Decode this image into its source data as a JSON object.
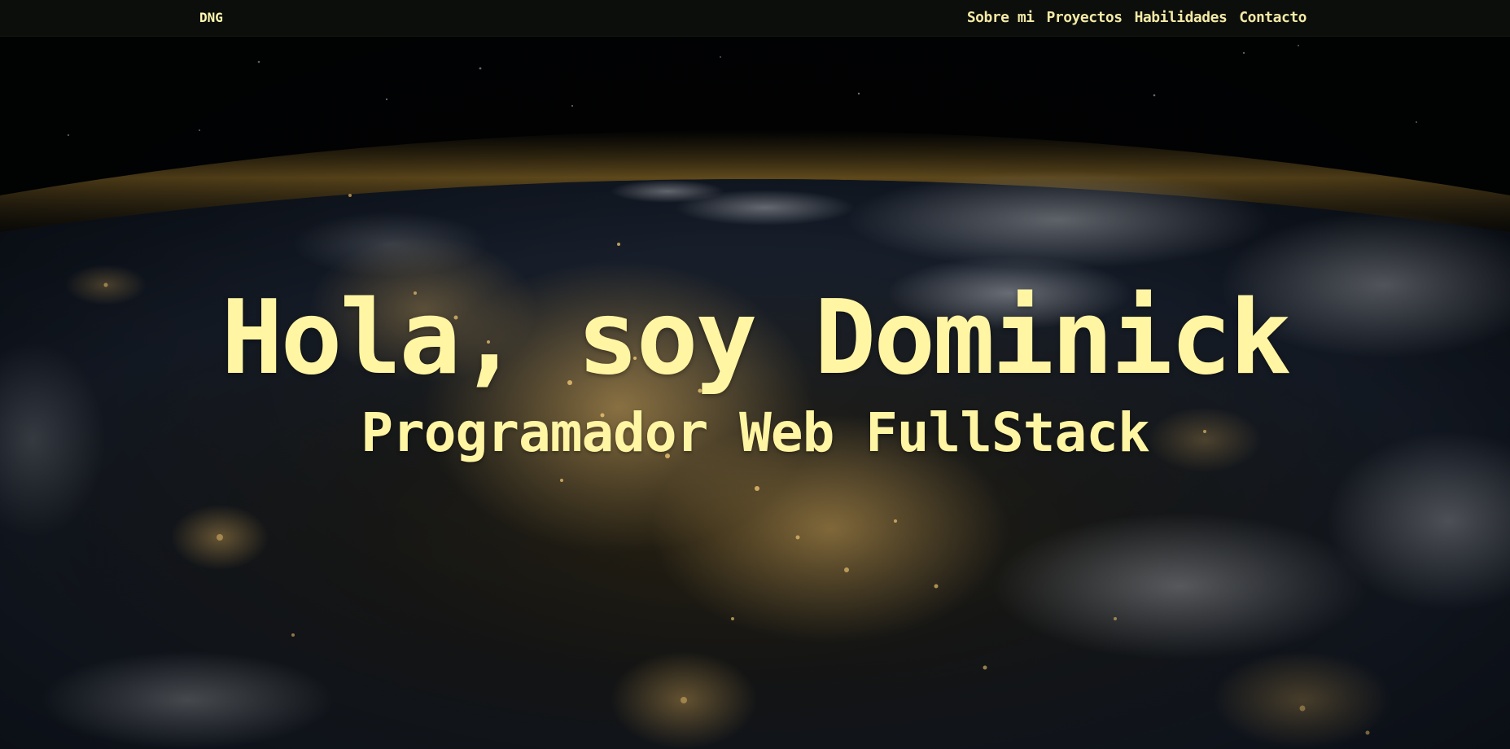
{
  "navbar": {
    "brand": "DNG",
    "links": [
      {
        "label": "Sobre mi"
      },
      {
        "label": "Proyectos"
      },
      {
        "label": "Habilidades"
      },
      {
        "label": "Contacto"
      }
    ]
  },
  "hero": {
    "title": "Hola, soy Dominick",
    "subtitle": "Programador Web FullStack"
  },
  "colors": {
    "accent_text": "#fff5a3",
    "navbar_bg": "#0b0e0a",
    "space_bg": "#020304",
    "atmosphere_glow": "#d8a640",
    "city_lights": "#f6c46a"
  }
}
